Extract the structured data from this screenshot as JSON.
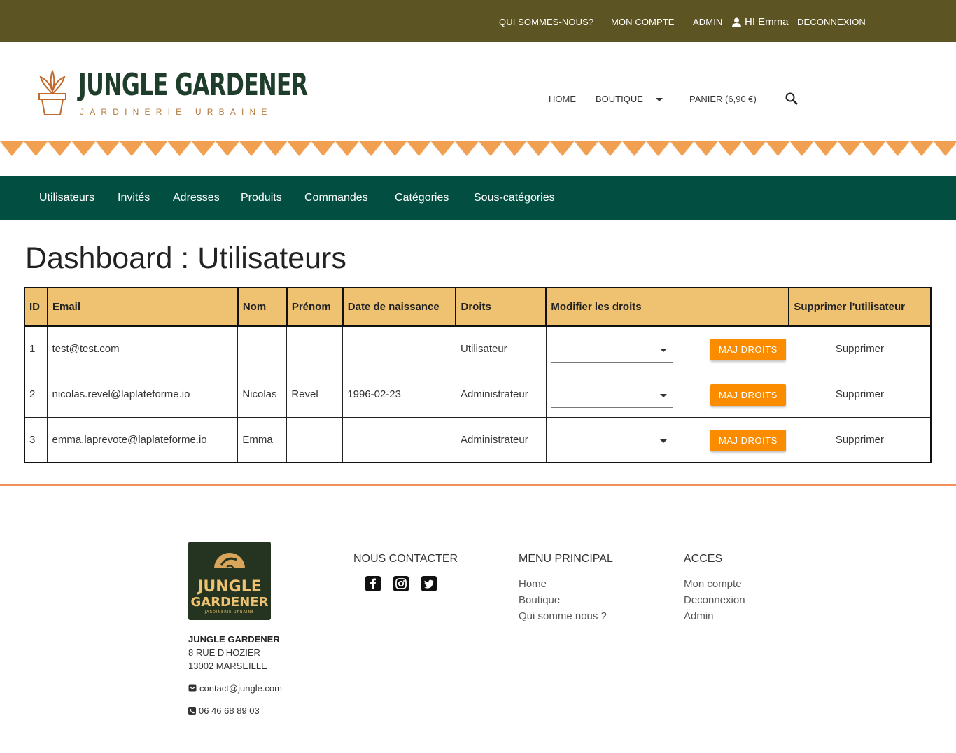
{
  "topbar": {
    "links": [
      "QUI SOMMES-NOUS?",
      "MON COMPTE",
      "ADMIN"
    ],
    "greeting": "HI Emma",
    "logout": "DECONNEXION"
  },
  "header": {
    "brand": "JUNGLE GARDENER",
    "tagline": "JARDINERIE URBAINE",
    "nav": [
      "HOME",
      "BOUTIQUE",
      "PANIER (6,90 €)"
    ],
    "search_placeholder": ""
  },
  "dashnav": {
    "items": [
      "Utilisateurs",
      "Invités",
      "Adresses",
      "Produits",
      "Commandes",
      "Catégories",
      "Sous-catégories"
    ]
  },
  "page": {
    "title": "Dashboard : Utilisateurs"
  },
  "table": {
    "headers": [
      "ID",
      "Email",
      "Nom",
      "Prénom",
      "Date de naissance",
      "Droits",
      "Modifier les droits",
      "Supprimer l'utilisateur"
    ],
    "rows": [
      {
        "id": "1",
        "email": "test@test.com",
        "nom": "",
        "prenom": "",
        "date": "",
        "droits": "Utilisateur"
      },
      {
        "id": "2",
        "email": "nicolas.revel@laplateforme.io",
        "nom": "Nicolas",
        "prenom": "Revel",
        "date": "1996-02-23",
        "droits": "Administrateur"
      },
      {
        "id": "3",
        "email": "emma.laprevote@laplateforme.io",
        "nom": "Emma",
        "prenom": "",
        "date": "",
        "droits": "Administrateur"
      }
    ],
    "maj_label": "MAJ DROITS",
    "delete_label": "Supprimer"
  },
  "footer": {
    "logo_line1": "JUNGLE",
    "logo_line2": "GARDENER",
    "logo_sub": "JARDINERIE URBAINE",
    "company": "JUNGLE GARDENER",
    "address1": "8 RUE D'HOZIER",
    "address2": "13002 MARSEILLE",
    "email": "contact@jungle.com",
    "phone": "06 46 68 89 03",
    "contact_title": "NOUS CONTACTER",
    "menu_title": "MENU PRINCIPAL",
    "menu_links": [
      "Home",
      "Boutique",
      "Qui somme nous ?"
    ],
    "access_title": "ACCES",
    "access_links": [
      "Mon compte",
      "Deconnexion",
      "Admin"
    ]
  },
  "colors": {
    "topbar": "#5d5424",
    "dashnav": "#024f41",
    "table_header": "#eec271",
    "button": "#fb8c00",
    "zigzag": "#f0a050",
    "separator": "#f0905a"
  }
}
